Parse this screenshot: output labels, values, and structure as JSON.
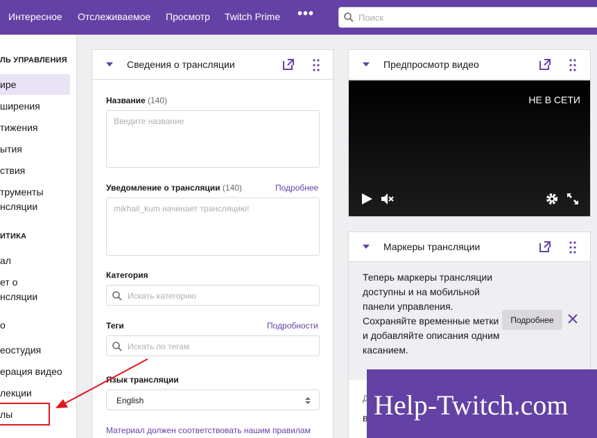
{
  "nav": {
    "items": [
      "Интересное",
      "Отслеживаемое",
      "Просмотр",
      "Twitch Prime"
    ],
    "more_label": "•••",
    "search_placeholder": "Поиск"
  },
  "sidebar": {
    "heading_control": "ЛЬ УПРАВЛЕНИЯ",
    "items_control": [
      "ире",
      "ширения",
      "тижения",
      "ытия",
      "ствия"
    ],
    "item_tools_line1": "трументы",
    "item_tools_line2": "нсляции",
    "heading_analytics": "ИТИКА",
    "item_channel": "ал",
    "item_report_line1": "ет о",
    "item_report_line2": "нсляции",
    "item_o": "о",
    "items_more": [
      "еостудия",
      "ерация видео",
      "лекции",
      "лы"
    ]
  },
  "stream_info": {
    "title": "Сведения о трансляции",
    "name_label": "Название",
    "name_count": "(140)",
    "name_placeholder": "Введите название",
    "notification_label": "Уведомление о трансляции",
    "notification_count": "(140)",
    "notification_link": "Подробнее",
    "notification_placeholder": "mikhail_kum начинает трансляцию!",
    "category_label": "Категория",
    "category_placeholder": "Искать категорию",
    "tags_label": "Теги",
    "tags_link": "Подробности",
    "tags_placeholder": "Искать по тегам",
    "language_label": "Язык трансляции",
    "language_value": "English",
    "footer_text": "Материал должен соответствовать нашим правилам"
  },
  "preview": {
    "title": "Предпросмотр видео",
    "offline_text": "НЕ В СЕТИ"
  },
  "markers": {
    "title": "Маркеры трансляции",
    "text": "Теперь маркеры трансляции доступны и на мобильной панели управления. Сохраняйте временные метки и добавляйте описания одним касанием.",
    "button_label": "Подробнее",
    "partial_1": "Д",
    "partial_2": "в"
  },
  "watermark": "Help-Twitch.com",
  "colors": {
    "brand": "#6441a4",
    "annotation": "#e3141c"
  }
}
